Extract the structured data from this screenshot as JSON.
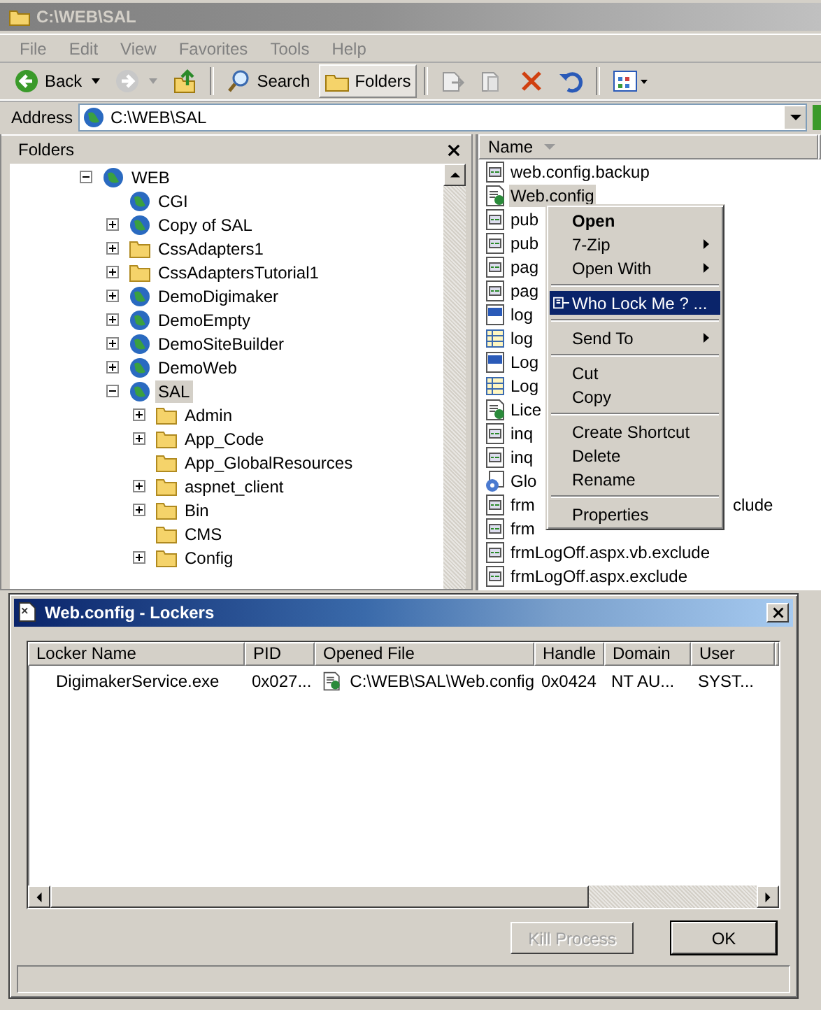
{
  "window": {
    "title": "C:\\WEB\\SAL"
  },
  "menu": [
    "File",
    "Edit",
    "View",
    "Favorites",
    "Tools",
    "Help"
  ],
  "toolbar": [
    {
      "kind": "back",
      "label": "Back",
      "selected": false
    },
    {
      "kind": "forward",
      "selected": false
    },
    {
      "kind": "up",
      "selected": false
    },
    {
      "kind": "search",
      "label": "Search",
      "selected": false
    },
    {
      "kind": "folders",
      "label": "Folders",
      "selected": true
    },
    {
      "kind": "move",
      "selected": false
    },
    {
      "kind": "copy",
      "selected": false
    },
    {
      "kind": "delete",
      "selected": false
    },
    {
      "kind": "undo",
      "selected": false
    },
    {
      "kind": "views",
      "selected": false
    }
  ],
  "address": {
    "label": "Address",
    "value": "C:\\WEB\\SAL"
  },
  "folders_pane": {
    "title": "Folders",
    "tree": [
      {
        "label": "WEB",
        "kind": "globe",
        "expanded": true,
        "selected": false,
        "children": [
          {
            "label": "CGI",
            "kind": "globe",
            "selected": false
          },
          {
            "label": "Copy of SAL",
            "kind": "globe",
            "expanded": false,
            "selected": false
          },
          {
            "label": "CssAdapters1",
            "kind": "folder",
            "expanded": false,
            "selected": false
          },
          {
            "label": "CssAdaptersTutorial1",
            "kind": "folder",
            "expanded": false,
            "selected": false
          },
          {
            "label": "DemoDigimaker",
            "kind": "globe",
            "expanded": false,
            "selected": false
          },
          {
            "label": "DemoEmpty",
            "kind": "globe",
            "expanded": false,
            "selected": false
          },
          {
            "label": "DemoSiteBuilder",
            "kind": "globe",
            "expanded": false,
            "selected": false
          },
          {
            "label": "DemoWeb",
            "kind": "globe",
            "expanded": false,
            "selected": false
          },
          {
            "label": "SAL",
            "kind": "globe",
            "expanded": true,
            "selected": true,
            "children": [
              {
                "label": "Admin",
                "kind": "folder",
                "expanded": false,
                "selected": false
              },
              {
                "label": "App_Code",
                "kind": "folder",
                "expanded": false,
                "selected": false
              },
              {
                "label": "App_GlobalResources",
                "kind": "folder",
                "selected": false
              },
              {
                "label": "aspnet_client",
                "kind": "folder",
                "expanded": false,
                "selected": false
              },
              {
                "label": "Bin",
                "kind": "folder",
                "expanded": false,
                "selected": false
              },
              {
                "label": "CMS",
                "kind": "folder",
                "selected": false
              },
              {
                "label": "Config",
                "kind": "folder",
                "expanded": false,
                "selected": false
              }
            ]
          }
        ]
      }
    ]
  },
  "file_list": {
    "columns": [
      "Name"
    ],
    "files": [
      {
        "name": "web.config.backup",
        "kind": "aspx",
        "selected": false
      },
      {
        "name": "Web.config",
        "kind": "config",
        "selected": true
      },
      {
        "name": "pub",
        "kind": "aspx",
        "selected": false
      },
      {
        "name": "pub",
        "kind": "aspx",
        "selected": false
      },
      {
        "name": "pag",
        "kind": "aspx",
        "selected": false
      },
      {
        "name": "pag",
        "kind": "aspx",
        "selected": false
      },
      {
        "name": "log",
        "kind": "vb",
        "selected": false
      },
      {
        "name": "log",
        "kind": "table",
        "selected": false
      },
      {
        "name": "Log",
        "kind": "vb",
        "selected": false
      },
      {
        "name": "Log",
        "kind": "table",
        "selected": false
      },
      {
        "name": "Lice",
        "kind": "config",
        "selected": false
      },
      {
        "name": "inq",
        "kind": "aspx",
        "selected": false
      },
      {
        "name": "inq",
        "kind": "aspx",
        "selected": false
      },
      {
        "name": "Glo",
        "kind": "global",
        "selected": false
      },
      {
        "name": "frm",
        "tail": "clude",
        "kind": "aspx",
        "selected": false
      },
      {
        "name": "frm",
        "kind": "aspx",
        "selected": false
      },
      {
        "name": "frmLogOff.aspx.vb.exclude",
        "kind": "aspx",
        "selected": false
      },
      {
        "name": "frmLogOff.aspx.exclude",
        "kind": "aspx",
        "selected": false
      }
    ]
  },
  "context_menu": [
    {
      "kind": "item",
      "label": "Open",
      "bold": true,
      "submenu": false,
      "selected": false
    },
    {
      "kind": "item",
      "label": "7-Zip",
      "bold": false,
      "submenu": true,
      "selected": false
    },
    {
      "kind": "item",
      "label": "Open With",
      "bold": false,
      "submenu": true,
      "selected": false
    },
    {
      "kind": "separator"
    },
    {
      "kind": "item",
      "label": "Who Lock Me ? ...",
      "bold": false,
      "submenu": false,
      "selected": true,
      "icon": true
    },
    {
      "kind": "separator"
    },
    {
      "kind": "item",
      "label": "Send To",
      "bold": false,
      "submenu": true,
      "selected": false
    },
    {
      "kind": "separator"
    },
    {
      "kind": "item",
      "label": "Cut",
      "bold": false,
      "submenu": false,
      "selected": false
    },
    {
      "kind": "item",
      "label": "Copy",
      "bold": false,
      "submenu": false,
      "selected": false
    },
    {
      "kind": "separator"
    },
    {
      "kind": "item",
      "label": "Create Shortcut",
      "bold": false,
      "submenu": false,
      "selected": false
    },
    {
      "kind": "item",
      "label": "Delete",
      "bold": false,
      "submenu": false,
      "selected": false
    },
    {
      "kind": "item",
      "label": "Rename",
      "bold": false,
      "submenu": false,
      "selected": false
    },
    {
      "kind": "separator"
    },
    {
      "kind": "item",
      "label": "Properties",
      "bold": false,
      "submenu": false,
      "selected": false
    }
  ],
  "dialog": {
    "title": "Web.config - Lockers",
    "columns": [
      "Locker Name",
      "PID",
      "Opened File",
      "Handle",
      "Domain",
      "User"
    ],
    "rows": [
      {
        "cells": [
          "DigimakerService.exe",
          "0x027...",
          "C:\\WEB\\SAL\\Web.config",
          "0x0424",
          "NT AU...",
          "SYST..."
        ]
      }
    ],
    "buttons": [
      {
        "label": "Kill Process",
        "disabled": true
      },
      {
        "label": "OK",
        "disabled": false
      }
    ]
  }
}
